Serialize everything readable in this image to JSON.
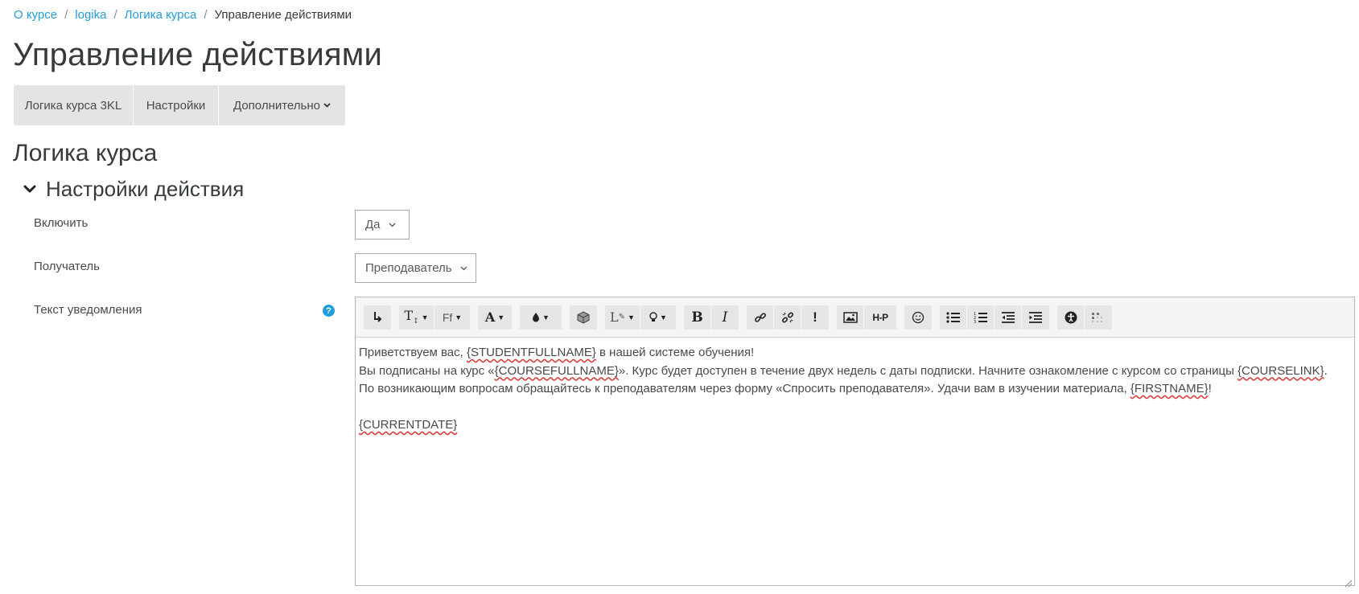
{
  "breadcrumb": {
    "items": [
      "О курсе",
      "logika",
      "Логика курса"
    ],
    "current": "Управление действиями"
  },
  "page_title": "Управление действиями",
  "tabs": [
    {
      "label": "Логика курса 3KL"
    },
    {
      "label": "Настройки"
    },
    {
      "label": "Дополнительно"
    }
  ],
  "section_title": "Логика курса",
  "subsection_title": "Настройки действия",
  "form": {
    "enable": {
      "label": "Включить",
      "value": "Да"
    },
    "recipient": {
      "label": "Получатель",
      "value": "Преподаватель"
    },
    "notification": {
      "label": "Текст уведомления"
    }
  },
  "editor": {
    "toolbar_icons": [
      "enter-icon",
      "text-size-icon",
      "font-family-icon",
      "font-color-icon",
      "background-color-icon",
      "cube-icon",
      "style-icon",
      "lightbulb-icon",
      "bold-icon",
      "italic-icon",
      "link-icon",
      "unlink-icon",
      "exclamation-icon",
      "image-icon",
      "h5p-icon",
      "emoji-icon",
      "bullet-list-icon",
      "numbered-list-icon",
      "outdent-icon",
      "indent-icon",
      "accessibility-icon",
      "more-icon"
    ],
    "lines": [
      {
        "p1": "Приветствуем вас, ",
        "t1": "{STUDENTFULLNAME}",
        "p2": " в нашей системе обучения!"
      },
      {
        "p1": "Вы подписаны на курс «",
        "t1": "{COURSEFULLNAME}",
        "p2": "». Курс будет доступен в течение двух недель с даты подписки. Начните ознакомление с курсом со страницы ",
        "t2": "{COURSELINK}",
        "p3": "."
      },
      {
        "p1": "По возникающим вопросам обращайтесь к преподавателям через форму «Спросить преподавателя». Удачи вам в изучении материала, ",
        "t1": "{FIRSTNAME}",
        "p2": "!"
      },
      {
        "t1": "{CURRENTDATE}"
      }
    ]
  },
  "colors": {
    "link": "#1f9ed9",
    "tab_bg": "#e4e4e4",
    "help_icon": "#1f9ed9"
  }
}
